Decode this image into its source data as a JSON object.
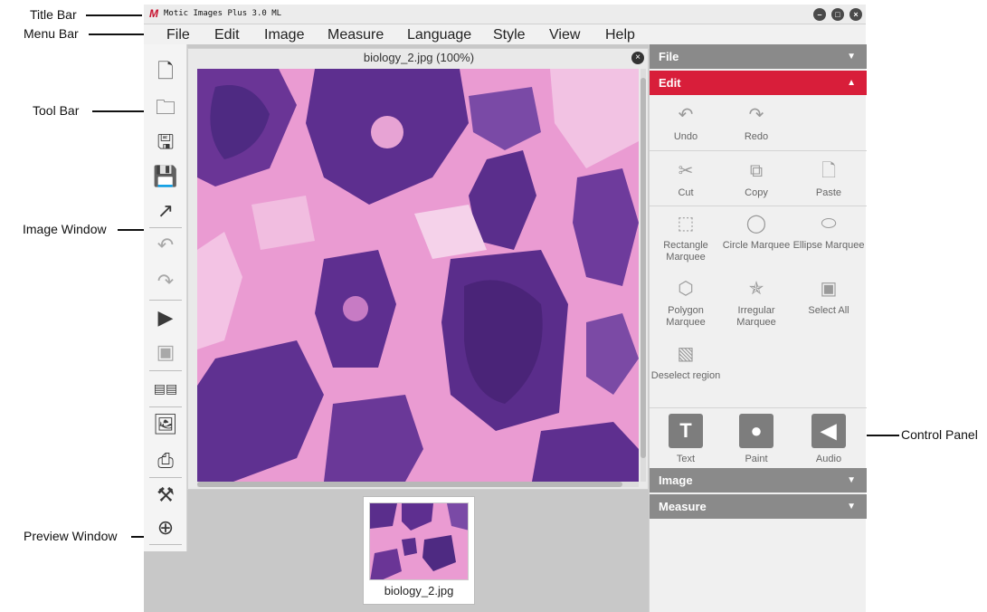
{
  "callouts": {
    "title_bar": "Title Bar",
    "menu_bar": "Menu Bar",
    "tool_bar": "Tool Bar",
    "image_window": "Image Window",
    "preview_window": "Preview Window",
    "control_panel": "Control Panel"
  },
  "app": {
    "title": "Motic Images Plus 3.0 ML",
    "logo": "M"
  },
  "menu": [
    "File",
    "Edit",
    "Image",
    "Measure",
    "Language",
    "Style",
    "View",
    "Help"
  ],
  "image_window": {
    "title": "biology_2.jpg (100%)"
  },
  "preview": {
    "caption": "biology_2.jpg"
  },
  "panel": {
    "file_header": "File",
    "edit_header": "Edit",
    "image_header": "Image",
    "measure_header": "Measure",
    "undo": "Undo",
    "redo": "Redo",
    "cut": "Cut",
    "copy": "Copy",
    "paste": "Paste",
    "rect_marquee": "Rectangle Marquee",
    "circle_marquee": "Circle Marquee",
    "ellipse_marquee": "Ellipse Marquee",
    "polygon_marquee": "Polygon Marquee",
    "irregular_marquee": "Irregular Marquee",
    "select_all": "Select All",
    "deselect_region": "Deselect region",
    "text": "Text",
    "paint": "Paint",
    "audio": "Audio"
  },
  "colors": {
    "accent_red": "#d81e3a",
    "section_gray": "#8a8a8a",
    "tissue_pink": "#e995cf",
    "tissue_purple": "#5a2e8c"
  }
}
